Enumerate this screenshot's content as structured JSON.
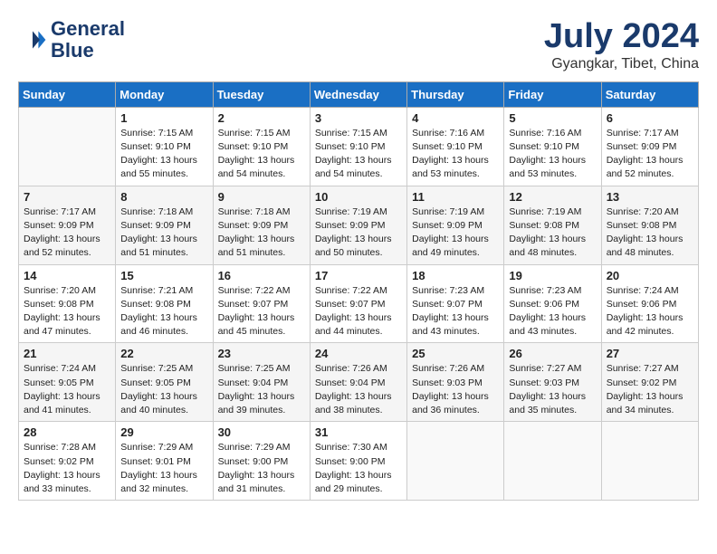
{
  "header": {
    "logo_line1": "General",
    "logo_line2": "Blue",
    "month": "July 2024",
    "location": "Gyangkar, Tibet, China"
  },
  "weekdays": [
    "Sunday",
    "Monday",
    "Tuesday",
    "Wednesday",
    "Thursday",
    "Friday",
    "Saturday"
  ],
  "weeks": [
    [
      {
        "day": "",
        "text": ""
      },
      {
        "day": "1",
        "text": "Sunrise: 7:15 AM\nSunset: 9:10 PM\nDaylight: 13 hours\nand 55 minutes."
      },
      {
        "day": "2",
        "text": "Sunrise: 7:15 AM\nSunset: 9:10 PM\nDaylight: 13 hours\nand 54 minutes."
      },
      {
        "day": "3",
        "text": "Sunrise: 7:15 AM\nSunset: 9:10 PM\nDaylight: 13 hours\nand 54 minutes."
      },
      {
        "day": "4",
        "text": "Sunrise: 7:16 AM\nSunset: 9:10 PM\nDaylight: 13 hours\nand 53 minutes."
      },
      {
        "day": "5",
        "text": "Sunrise: 7:16 AM\nSunset: 9:10 PM\nDaylight: 13 hours\nand 53 minutes."
      },
      {
        "day": "6",
        "text": "Sunrise: 7:17 AM\nSunset: 9:09 PM\nDaylight: 13 hours\nand 52 minutes."
      }
    ],
    [
      {
        "day": "7",
        "text": "Sunrise: 7:17 AM\nSunset: 9:09 PM\nDaylight: 13 hours\nand 52 minutes."
      },
      {
        "day": "8",
        "text": "Sunrise: 7:18 AM\nSunset: 9:09 PM\nDaylight: 13 hours\nand 51 minutes."
      },
      {
        "day": "9",
        "text": "Sunrise: 7:18 AM\nSunset: 9:09 PM\nDaylight: 13 hours\nand 51 minutes."
      },
      {
        "day": "10",
        "text": "Sunrise: 7:19 AM\nSunset: 9:09 PM\nDaylight: 13 hours\nand 50 minutes."
      },
      {
        "day": "11",
        "text": "Sunrise: 7:19 AM\nSunset: 9:09 PM\nDaylight: 13 hours\nand 49 minutes."
      },
      {
        "day": "12",
        "text": "Sunrise: 7:19 AM\nSunset: 9:08 PM\nDaylight: 13 hours\nand 48 minutes."
      },
      {
        "day": "13",
        "text": "Sunrise: 7:20 AM\nSunset: 9:08 PM\nDaylight: 13 hours\nand 48 minutes."
      }
    ],
    [
      {
        "day": "14",
        "text": "Sunrise: 7:20 AM\nSunset: 9:08 PM\nDaylight: 13 hours\nand 47 minutes."
      },
      {
        "day": "15",
        "text": "Sunrise: 7:21 AM\nSunset: 9:08 PM\nDaylight: 13 hours\nand 46 minutes."
      },
      {
        "day": "16",
        "text": "Sunrise: 7:22 AM\nSunset: 9:07 PM\nDaylight: 13 hours\nand 45 minutes."
      },
      {
        "day": "17",
        "text": "Sunrise: 7:22 AM\nSunset: 9:07 PM\nDaylight: 13 hours\nand 44 minutes."
      },
      {
        "day": "18",
        "text": "Sunrise: 7:23 AM\nSunset: 9:07 PM\nDaylight: 13 hours\nand 43 minutes."
      },
      {
        "day": "19",
        "text": "Sunrise: 7:23 AM\nSunset: 9:06 PM\nDaylight: 13 hours\nand 43 minutes."
      },
      {
        "day": "20",
        "text": "Sunrise: 7:24 AM\nSunset: 9:06 PM\nDaylight: 13 hours\nand 42 minutes."
      }
    ],
    [
      {
        "day": "21",
        "text": "Sunrise: 7:24 AM\nSunset: 9:05 PM\nDaylight: 13 hours\nand 41 minutes."
      },
      {
        "day": "22",
        "text": "Sunrise: 7:25 AM\nSunset: 9:05 PM\nDaylight: 13 hours\nand 40 minutes."
      },
      {
        "day": "23",
        "text": "Sunrise: 7:25 AM\nSunset: 9:04 PM\nDaylight: 13 hours\nand 39 minutes."
      },
      {
        "day": "24",
        "text": "Sunrise: 7:26 AM\nSunset: 9:04 PM\nDaylight: 13 hours\nand 38 minutes."
      },
      {
        "day": "25",
        "text": "Sunrise: 7:26 AM\nSunset: 9:03 PM\nDaylight: 13 hours\nand 36 minutes."
      },
      {
        "day": "26",
        "text": "Sunrise: 7:27 AM\nSunset: 9:03 PM\nDaylight: 13 hours\nand 35 minutes."
      },
      {
        "day": "27",
        "text": "Sunrise: 7:27 AM\nSunset: 9:02 PM\nDaylight: 13 hours\nand 34 minutes."
      }
    ],
    [
      {
        "day": "28",
        "text": "Sunrise: 7:28 AM\nSunset: 9:02 PM\nDaylight: 13 hours\nand 33 minutes."
      },
      {
        "day": "29",
        "text": "Sunrise: 7:29 AM\nSunset: 9:01 PM\nDaylight: 13 hours\nand 32 minutes."
      },
      {
        "day": "30",
        "text": "Sunrise: 7:29 AM\nSunset: 9:00 PM\nDaylight: 13 hours\nand 31 minutes."
      },
      {
        "day": "31",
        "text": "Sunrise: 7:30 AM\nSunset: 9:00 PM\nDaylight: 13 hours\nand 29 minutes."
      },
      {
        "day": "",
        "text": ""
      },
      {
        "day": "",
        "text": ""
      },
      {
        "day": "",
        "text": ""
      }
    ]
  ]
}
